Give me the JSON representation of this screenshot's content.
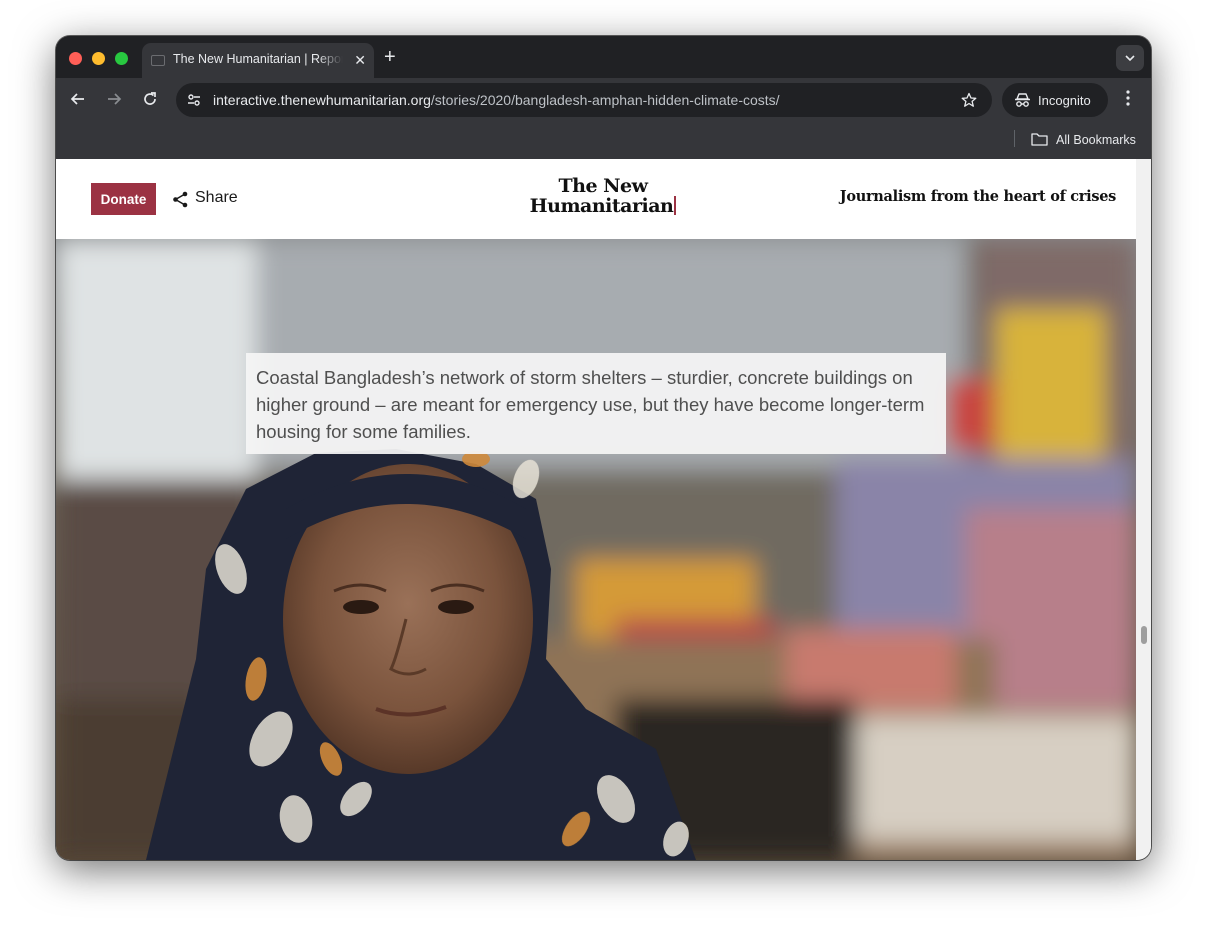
{
  "browser": {
    "tab_title": "The New Humanitarian | Reporting from the heart of crises",
    "tab_close": "✕",
    "new_tab": "+",
    "url_host": "interactive.thenewhumanitarian.org",
    "url_path": "/stories/2020/bangladesh-amphan-hidden-climate-costs/",
    "profile_label": "Incognito",
    "bookmarks_label": "All Bookmarks"
  },
  "site": {
    "donate_label": "Donate",
    "share_label": "Share",
    "logo_line1": "The New",
    "logo_line2": "Humanitarian",
    "tagline": "Journalism from the heart of crises",
    "brand_color": "#9b3243"
  },
  "hero": {
    "caption": "Coastal Bangladesh’s network of storm shelters – sturdier, concrete buildings on higher ground – are meant for emergency use, but they have become longer-term housing for some families."
  }
}
